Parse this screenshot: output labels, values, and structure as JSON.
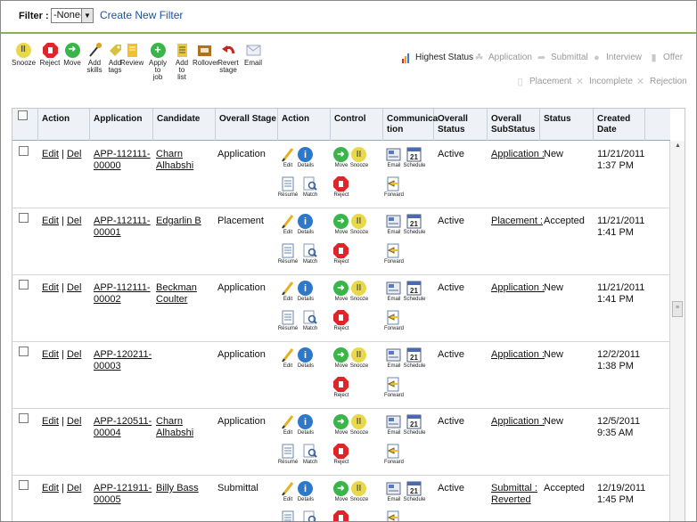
{
  "filter": {
    "label": "Filter :",
    "selected": "-None-",
    "create_link": "Create New Filter"
  },
  "toolbar": [
    {
      "id": "snooze",
      "label": "Snooze",
      "icon": "pause-circle-icon",
      "color": "#e8d84a"
    },
    {
      "id": "reject",
      "label": "Reject",
      "icon": "stop-octagon-icon",
      "color": "#e0242a"
    },
    {
      "id": "move",
      "label": "Move",
      "icon": "arrow-right-circle-icon",
      "color": "#3ab54a"
    },
    {
      "id": "add-skills",
      "label": "Add skills",
      "icon": "wand-icon",
      "color": "#e0a020"
    },
    {
      "id": "add-tags",
      "label": "Add tags",
      "icon": "tag-icon",
      "color": "#d8c040"
    },
    {
      "id": "review",
      "label": "Review",
      "icon": "note-icon",
      "color": "#f0c030"
    },
    {
      "id": "apply-to-job",
      "label": "Apply to job",
      "icon": "plus-circle-icon",
      "color": "#3ab54a"
    },
    {
      "id": "add-to-list",
      "label": "Add to list",
      "icon": "list-icon",
      "color": "#e8c840"
    },
    {
      "id": "rollover",
      "label": "Rollover",
      "icon": "rollover-icon",
      "color": "#b07020"
    },
    {
      "id": "revert-stage",
      "label": "Revert stage",
      "icon": "undo-arrow-icon",
      "color": "#c02820"
    },
    {
      "id": "email",
      "label": "Email",
      "icon": "email-icon",
      "color": "#9aa8c0"
    }
  ],
  "legend": {
    "highest_status": "Highest Status",
    "application": "Application",
    "submittal": "Submittal",
    "interview": "Interview",
    "offer": "Offer",
    "placement": "Placement",
    "incomplete": "Incomplete",
    "rejection": "Rejection"
  },
  "columns": {
    "action": "Action",
    "application": "Application",
    "candidate": "Candidate",
    "overall_stage": "Overall Stage",
    "action2": "Action",
    "control": "Control",
    "communication_1": "Communica",
    "communication_2": "tion",
    "overall_status_1": "Overall",
    "overall_status_2": "Status",
    "overall_substatus_1": "Overall",
    "overall_substatus_2": "SubStatus",
    "status": "Status",
    "created_1": "Created",
    "created_2": "Date"
  },
  "row_labels": {
    "edit": "Edit",
    "sep": "|",
    "del": "Del",
    "mini_edit": "Edit",
    "mini_details": "Details",
    "mini_resume": "Résumé",
    "mini_match": "Match",
    "mini_move": "Move",
    "mini_snooze": "Snooze",
    "mini_reject": "Reject",
    "mini_email": "Email",
    "mini_schedule": "Schedule",
    "mini_forward": "Forward",
    "calendar_day": "21"
  },
  "rows": [
    {
      "app1": "APP-112111-",
      "app2": "00000",
      "cand1": "Charn",
      "cand2": "Alhabshi",
      "stage": "Application",
      "ostatus": "Active",
      "sub1": "Application :",
      "sub2": "",
      "status": "New",
      "date1": "11/21/2011",
      "date2": "1:37 PM",
      "resume": true
    },
    {
      "app1": "APP-112111-",
      "app2": "00001",
      "cand1": "Edgarlin B",
      "cand2": "",
      "stage": "Placement",
      "ostatus": "Active",
      "sub1": "Placement :",
      "sub2": "",
      "status": "Accepted",
      "date1": "11/21/2011",
      "date2": "1:41 PM",
      "resume": true
    },
    {
      "app1": "APP-112111-",
      "app2": "00002",
      "cand1": "Beckman",
      "cand2": "Coulter",
      "stage": "Application",
      "ostatus": "Active",
      "sub1": "Application :",
      "sub2": "",
      "status": "New",
      "date1": "11/21/2011",
      "date2": "1:41 PM",
      "resume": true
    },
    {
      "app1": "APP-120211-",
      "app2": "00003",
      "cand1": "",
      "cand2": "",
      "stage": "Application",
      "ostatus": "Active",
      "sub1": "Application :",
      "sub2": "",
      "status": "New",
      "date1": "12/2/2011",
      "date2": "1:38 PM",
      "resume": false
    },
    {
      "app1": "APP-120511-",
      "app2": "00004",
      "cand1": "Charn",
      "cand2": "Alhabshi",
      "stage": "Application",
      "ostatus": "Active",
      "sub1": "Application :",
      "sub2": "",
      "status": "New",
      "date1": "12/5/2011",
      "date2": "9:35 AM",
      "resume": true
    },
    {
      "app1": "APP-121911-",
      "app2": "00005",
      "cand1": "Billy Bass",
      "cand2": "",
      "stage": "Submittal",
      "ostatus": "Active",
      "sub1": "Submittal :",
      "sub2": "Reverted",
      "status": "Accepted",
      "date1": "12/19/2011",
      "date2": "1:45 PM",
      "resume": true
    }
  ]
}
